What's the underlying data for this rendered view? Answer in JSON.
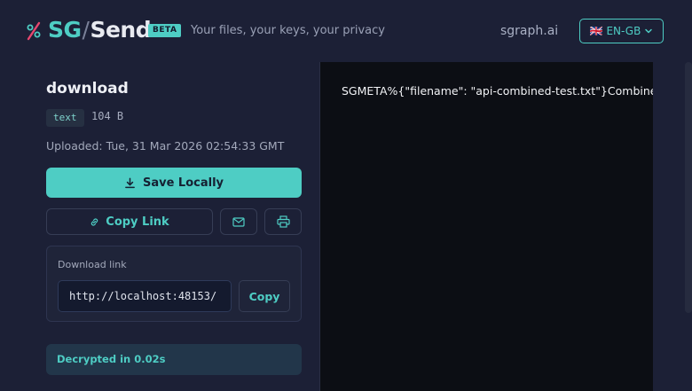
{
  "header": {
    "brand_sg": "SG",
    "brand_slash": "/",
    "brand_send": "Send",
    "beta": "BETA",
    "tagline": "Your files, your keys, your privacy",
    "site": "sgraph.ai",
    "language": "🇬🇧 EN-GB",
    "language_icon": "chevron-down-icon"
  },
  "file": {
    "name": "download",
    "type": "text",
    "size": "104 B",
    "uploaded": "Uploaded: Tue, 31 Mar 2026 02:54:33 GMT"
  },
  "actions": {
    "save_label": "Save Locally",
    "copy_link_label": "Copy Link",
    "save_icon": "download-icon",
    "copy_link_icon": "link-icon",
    "mail_icon": "mail-icon",
    "print_icon": "printer-icon"
  },
  "download_link": {
    "label": "Download link",
    "value": "http://localhost:48153/",
    "copy_label": "Copy"
  },
  "status": {
    "decrypted": "Decrypted in 0.02s"
  },
  "viewer": {
    "content": "SGMETA%{\"filename\": \"api-combined-test.txt\"}Combined"
  },
  "colors": {
    "accent": "#4ecdc4",
    "background": "#1c2036",
    "viewer_bg": "#0c0e14"
  }
}
